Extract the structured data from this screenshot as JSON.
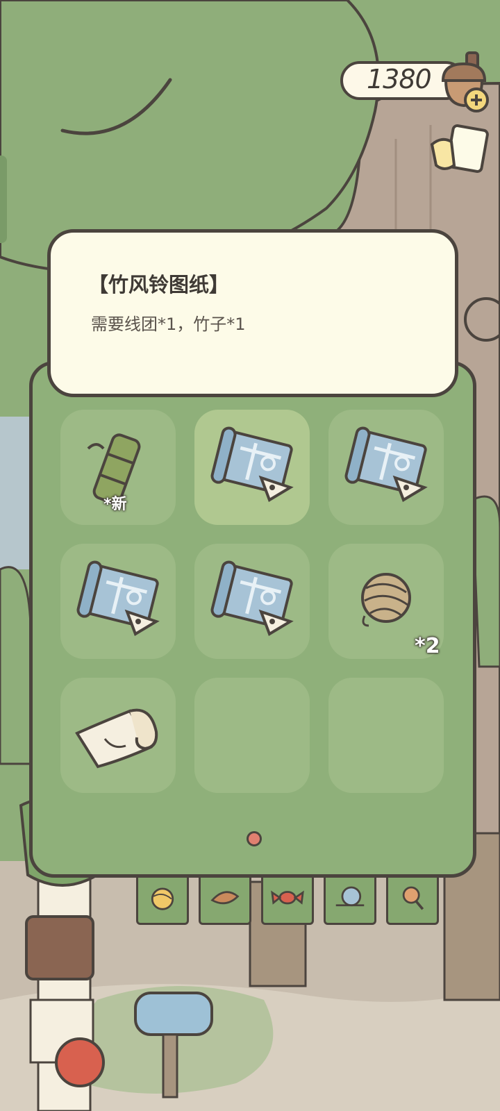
{
  "currency": {
    "amount": "1380",
    "icon": "acorn-icon",
    "add_icon": "plus-icon"
  },
  "item_info": {
    "title": "【竹风铃图纸】",
    "description": "需要线团*1，竹子*1"
  },
  "inventory": {
    "slots": [
      {
        "icon": "bamboo-icon",
        "tag": "*新",
        "count": "",
        "selected": false
      },
      {
        "icon": "blueprint-icon",
        "tag": "",
        "count": "",
        "selected": true
      },
      {
        "icon": "blueprint-icon",
        "tag": "",
        "count": "",
        "selected": false
      },
      {
        "icon": "blueprint-icon",
        "tag": "",
        "count": "",
        "selected": false
      },
      {
        "icon": "blueprint-icon",
        "tag": "",
        "count": "",
        "selected": false
      },
      {
        "icon": "yarn-ball-icon",
        "tag": "",
        "count": "*2",
        "selected": false
      },
      {
        "icon": "scroll-paper-icon",
        "tag": "",
        "count": "",
        "selected": false
      },
      {
        "icon": "",
        "tag": "",
        "count": "",
        "selected": false
      },
      {
        "icon": "",
        "tag": "",
        "count": "",
        "selected": false
      }
    ],
    "page_current": 1,
    "page_total": 1
  },
  "category_tabs": [
    "yarn-icon",
    "leaf-icon",
    "candy-icon",
    "snail-icon",
    "magnifier-icon"
  ],
  "colors": {
    "panel": "#8fb07a",
    "slot": "#9dba86",
    "slot_selected": "#b0c890",
    "card": "#fdfbe8",
    "outline": "#4b443e",
    "page_dot": "#e08070"
  }
}
